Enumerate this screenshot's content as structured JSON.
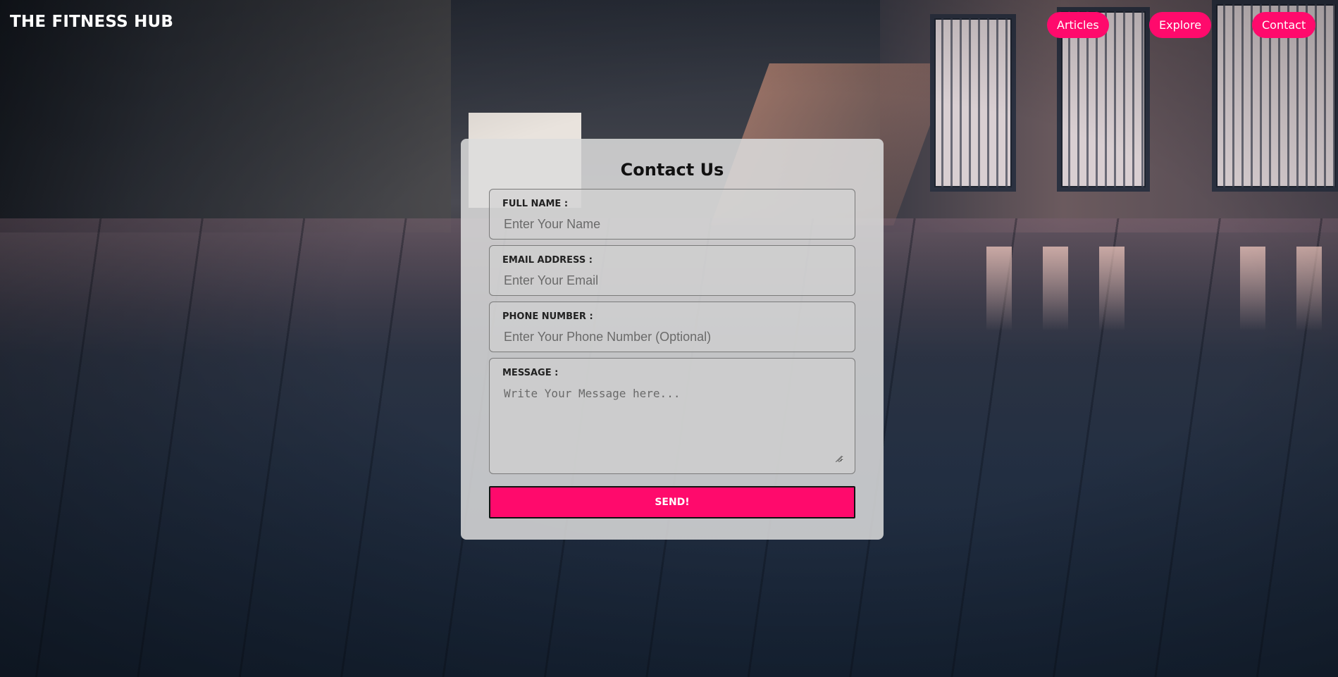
{
  "brand": {
    "title": "THE FITNESS HUB"
  },
  "nav": {
    "items": [
      {
        "label": "Articles"
      },
      {
        "label": "Explore"
      },
      {
        "label": "Contact"
      }
    ]
  },
  "contact_form": {
    "title": "Contact Us",
    "fields": {
      "name": {
        "label": "FULL NAME :",
        "value": "",
        "placeholder": "Enter Your Name"
      },
      "email": {
        "label": "EMAIL ADDRESS :",
        "value": "",
        "placeholder": "Enter Your Email"
      },
      "phone": {
        "label": "PHONE NUMBER :",
        "value": "",
        "placeholder": "Enter Your Phone Number (Optional)"
      },
      "message": {
        "label": "MESSAGE :",
        "value": "",
        "placeholder": "Write Your Message here..."
      }
    },
    "submit_label": "SEND!"
  },
  "colors": {
    "accent": "#ff0a6c",
    "card_background": "rgba(220,220,220,0.86)",
    "text_dark": "#111111"
  },
  "icons": {
    "textarea_resize": "resize-grip-icon"
  }
}
